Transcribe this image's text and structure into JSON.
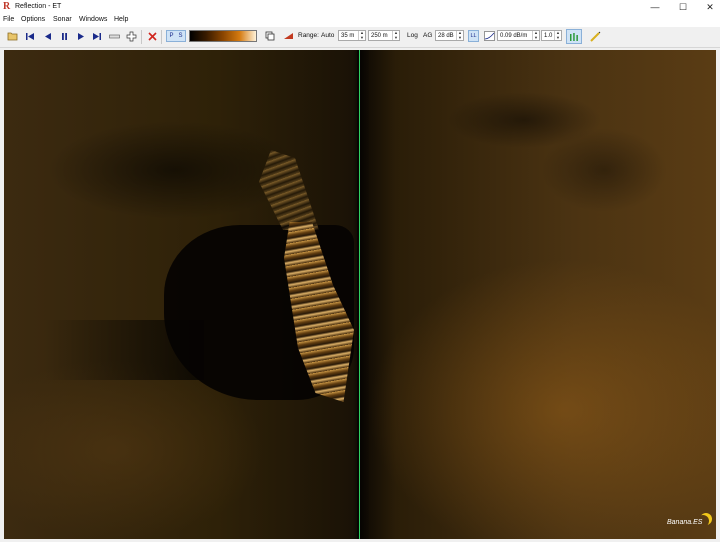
{
  "window": {
    "title": "Reflection - ET",
    "logo_letter": "R",
    "minimize": "—",
    "maximize": "☐",
    "close": "✕"
  },
  "menu": [
    "File",
    "Options",
    "Sonar",
    "Windows",
    "Help"
  ],
  "toolbar": {
    "port_label": "P",
    "starboard_label": "S",
    "range_label": "Range:",
    "auto_label": "Auto",
    "range_near": "35 m",
    "range_far": "250 m",
    "log_label": "Log",
    "ag_label": "AG",
    "gain": "28 dB",
    "ll_label": "LL",
    "attenuation": "0.09 dB/m",
    "factor": "1.0"
  },
  "watermark": "Banana.ES",
  "colors": {
    "center_line": "#30d060",
    "sonar_tint": "#b07a28"
  }
}
